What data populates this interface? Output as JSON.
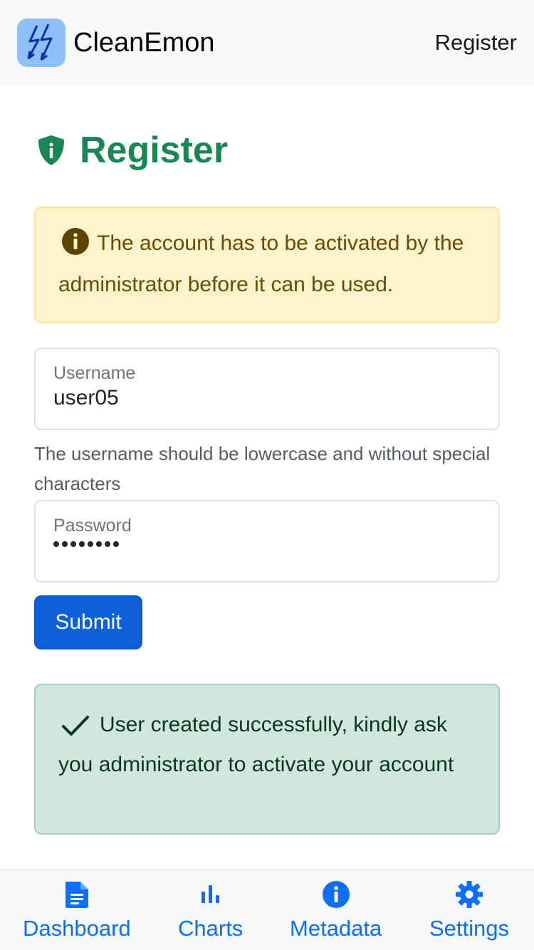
{
  "navbar": {
    "brand": "CleanEmon",
    "logo_icon": "lightning-bolt-icon",
    "link": "Register"
  },
  "page": {
    "title": "Register",
    "title_icon": "shield-info-icon"
  },
  "warning_alert": {
    "icon": "info-circle-icon",
    "text": "The account has to be activated by the administrator before it can be used."
  },
  "form": {
    "username": {
      "label": "Username",
      "value": "user05",
      "help": "The username should be lowercase and without special characters"
    },
    "password": {
      "label": "Password",
      "masked_length": 8
    },
    "submit_label": "Submit"
  },
  "success_alert": {
    "icon": "check-icon",
    "text": "User created successfully, kindly ask you administrator to activate your account"
  },
  "tabbar": {
    "tabs": [
      {
        "label": "Dashboard",
        "icon": "document-icon"
      },
      {
        "label": "Charts",
        "icon": "bar-chart-icon"
      },
      {
        "label": "Metadata",
        "icon": "info-circle-icon"
      },
      {
        "label": "Settings",
        "icon": "gear-icon"
      }
    ]
  },
  "colors": {
    "brand_green": "#198754",
    "primary": "#0d6efd",
    "warning_bg": "#fff3cd",
    "success_bg": "#d1e7dd"
  }
}
